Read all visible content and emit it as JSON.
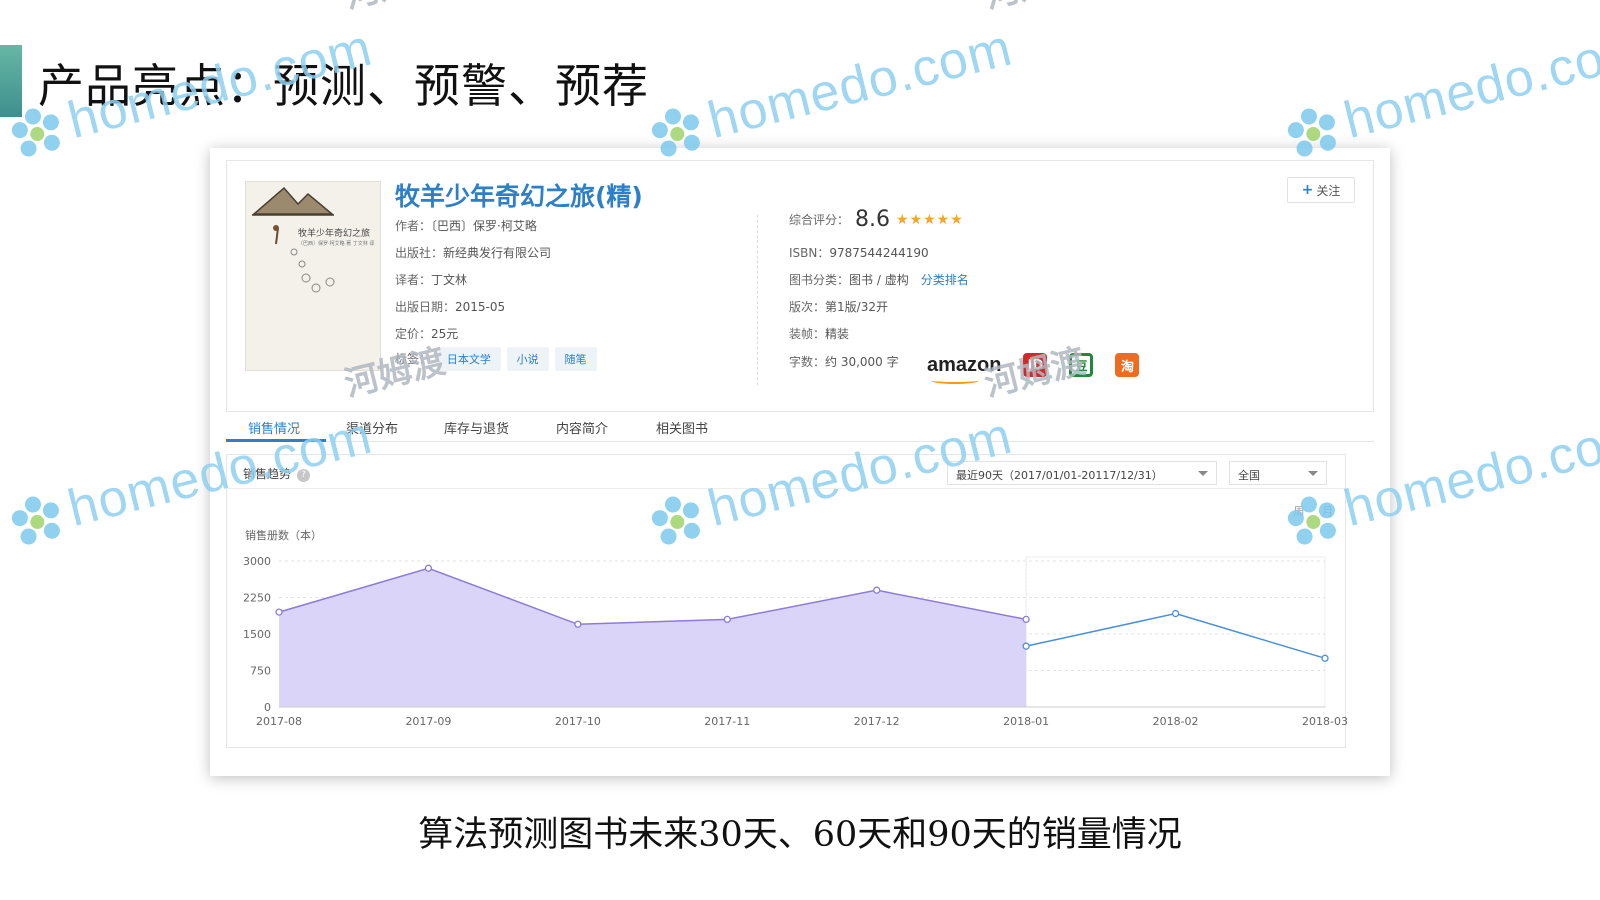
{
  "slide": {
    "title": "产品亮点：预测、预警、预荐",
    "caption": "算法预测图书未来30天、60天和90天的销量情况"
  },
  "book": {
    "title": "牧羊少年奇幻之旅(精)",
    "cover_title": "牧羊少年奇幻之旅",
    "cover_subtitle": "〔巴西〕保罗·柯艾略 著 丁文林 译",
    "follow_label": "关注",
    "left": [
      {
        "label": "作者：",
        "value": "〔巴西〕保罗·柯艾略"
      },
      {
        "label": "出版社：",
        "value": "新经典发行有限公司"
      },
      {
        "label": "译者：",
        "value": "丁文林"
      },
      {
        "label": "出版日期：",
        "value": "2015-05"
      },
      {
        "label": "定价：",
        "value": "25元"
      }
    ],
    "tags_label": "标签：",
    "tags": [
      "日本文学",
      "小说",
      "随笔"
    ],
    "rating_label": "综合评分：",
    "rating": "8.6",
    "stars": "★★★★★",
    "right": [
      {
        "label": "ISBN：",
        "value": "9787544244190"
      },
      {
        "label": "图书分类：",
        "value": "图书 / 虚构",
        "link": "分类排名"
      },
      {
        "label": "版次：",
        "value": "第1版/32开"
      },
      {
        "label": "装帧：",
        "value": "精装"
      }
    ],
    "word_count_label": "字数：",
    "word_count": "约 30,000 字",
    "stores": {
      "amazon": "amazon",
      "jd": "JD",
      "douban": "豆",
      "taobao": "淘"
    }
  },
  "tabs": [
    "销售情况",
    "渠道分布",
    "库存与退货",
    "内容简介",
    "相关图书"
  ],
  "trend": {
    "label": "销售趋势",
    "range_select": "最近90天（2017/01/01-20117/12/31）",
    "region_select": "全国",
    "period_week": "周",
    "period_month": "月"
  },
  "chart_data": {
    "type": "area",
    "ylabel": "销售册数（本）",
    "ylim": [
      0,
      3000
    ],
    "yticks": [
      0,
      750,
      1500,
      2250,
      3000
    ],
    "x": [
      "2017-08",
      "2017-09",
      "2017-10",
      "2017-11",
      "2017-12",
      "2018-01",
      "2018-02",
      "2018-03"
    ],
    "series": [
      {
        "kind": "actual",
        "x": [
          "2017-08",
          "2017-09",
          "2017-10",
          "2017-11",
          "2017-12",
          "2018-01"
        ],
        "values": [
          1950,
          2850,
          1700,
          1800,
          2400,
          1800
        ],
        "color": "#8e7bd6",
        "fill": "#d6d0f7"
      },
      {
        "kind": "forecast",
        "x": [
          "2018-01",
          "2018-02",
          "2018-03"
        ],
        "values": [
          1250,
          1920,
          1000
        ],
        "color": "#4a90d9"
      }
    ],
    "grid": true
  },
  "colors": {
    "accent": "#2d7fc8",
    "area_fill": "#d6d0f7",
    "area_line": "#8e7bd6",
    "forecast_line": "#4a90d9"
  },
  "watermark": {
    "text": "homedo.com",
    "cn": "河姆渡"
  }
}
